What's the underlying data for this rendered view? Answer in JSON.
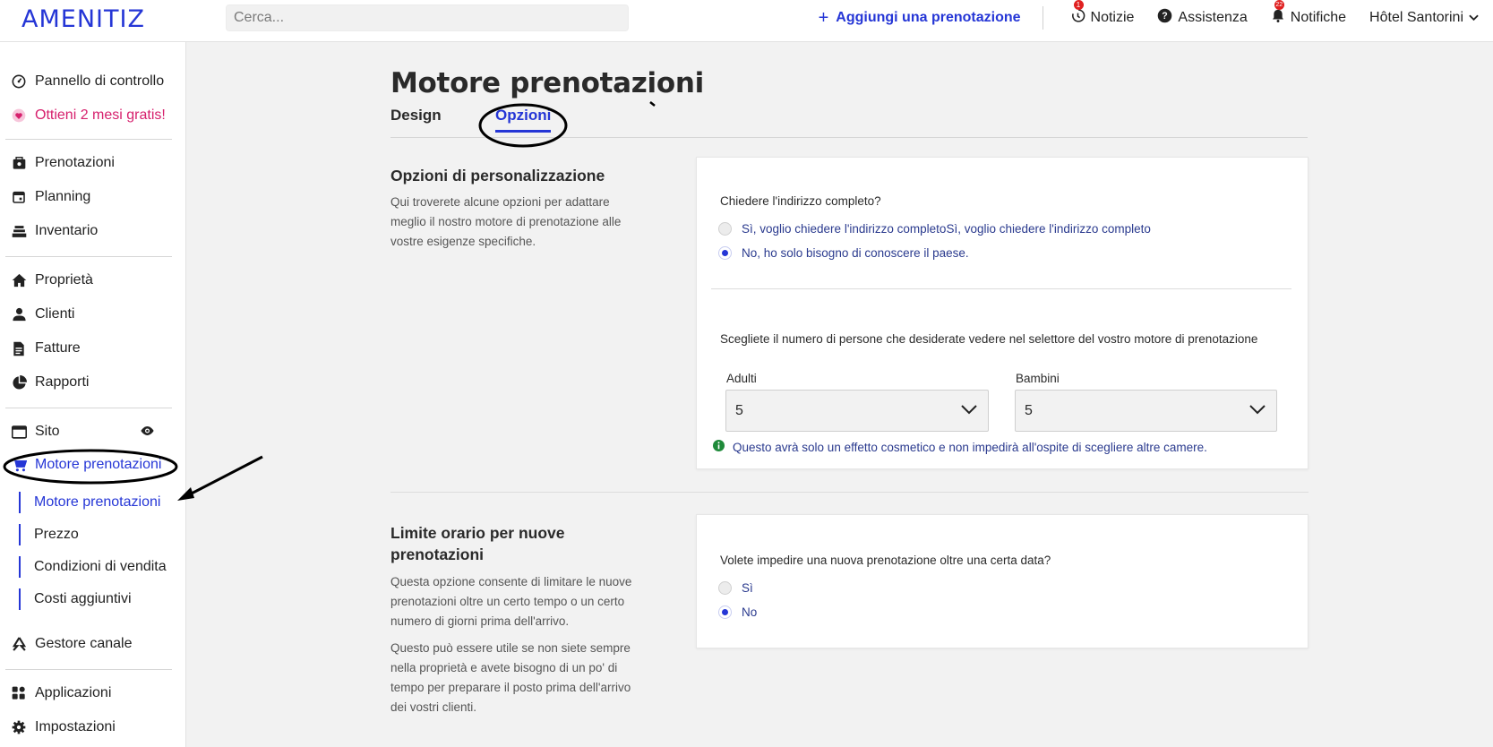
{
  "topbar": {
    "logo": "AMENITIZ",
    "search_placeholder": "Cerca...",
    "add_booking_label": "Aggiungi una prenotazione",
    "news_label": "Notizie",
    "news_badge": "1",
    "help_label": "Assistenza",
    "notifications_label": "Notifiche",
    "notifications_badge": "22",
    "hotel_name": "Hôtel Santorini"
  },
  "sidebar": {
    "items": [
      {
        "label": "Pannello di controllo",
        "icon": "dashboard-icon"
      },
      {
        "label": "Ottieni 2 mesi gratis!",
        "icon": "heart-icon"
      },
      {
        "label": "Prenotazioni",
        "icon": "bookings-icon"
      },
      {
        "label": "Planning",
        "icon": "calendar-icon"
      },
      {
        "label": "Inventario",
        "icon": "inventory-icon"
      },
      {
        "label": "Proprietà",
        "icon": "home-icon"
      },
      {
        "label": "Clienti",
        "icon": "clients-icon"
      },
      {
        "label": "Fatture",
        "icon": "invoice-icon"
      },
      {
        "label": "Rapporti",
        "icon": "pie-chart-icon"
      },
      {
        "label": "Sito",
        "icon": "browser-icon"
      },
      {
        "label": "Motore prenotazioni",
        "icon": "cart-icon"
      },
      {
        "label": "Gestore canale",
        "icon": "channel-manager-icon"
      },
      {
        "label": "Applicazioni",
        "icon": "apps-icon"
      },
      {
        "label": "Impostazioni",
        "icon": "gear-icon"
      }
    ],
    "subitems": [
      {
        "label": "Motore prenotazioni"
      },
      {
        "label": "Prezzo"
      },
      {
        "label": "Condizioni di vendita"
      },
      {
        "label": "Costi aggiuntivi"
      }
    ]
  },
  "main": {
    "title": "Motore prenotazioni",
    "tabs": [
      {
        "label": "Design",
        "active": false
      },
      {
        "label": "Opzioni",
        "active": true
      }
    ],
    "section1": {
      "title": "Opzioni di personalizzazione",
      "desc": "Qui troverete alcune opzioni per adattare meglio il nostro motore di prenotazione alle vostre esigenze specifiche.",
      "address_question": "Chiedere l'indirizzo completo?",
      "address_options": [
        {
          "label": "Sì, voglio chiedere l'indirizzo completoSì, voglio chiedere l'indirizzo completo",
          "checked": false
        },
        {
          "label": "No, ho solo bisogno di conoscere il paese.",
          "checked": true
        }
      ],
      "people_question": "Scegliete il numero di persone che desiderate vedere nel selettore del vostro motore di prenotazione",
      "adults_label": "Adulti",
      "adults_value": "5",
      "children_label": "Bambini",
      "children_value": "5",
      "info_note": "Questo avrà solo un effetto cosmetico e non impedirà all'ospite di scegliere altre camere."
    },
    "section2": {
      "title": "Limite orario per nuove prenotazioni",
      "desc1": "Questa opzione consente di limitare le nuove prenotazioni oltre un certo tempo o un certo numero di giorni prima dell'arrivo.",
      "desc2": "Questo può essere utile se non siete sempre nella proprietà e avete bisogno di un po' di tempo per preparare il posto prima dell'arrivo dei vostri clienti.",
      "question": "Volete impedire una nuova prenotazione oltre una certa data?",
      "options": [
        {
          "label": "Sì",
          "checked": false
        },
        {
          "label": "No",
          "checked": true
        }
      ]
    }
  },
  "colors": {
    "accent": "#2536d6",
    "promo": "#d6206d",
    "info": "#1f8a3a"
  }
}
